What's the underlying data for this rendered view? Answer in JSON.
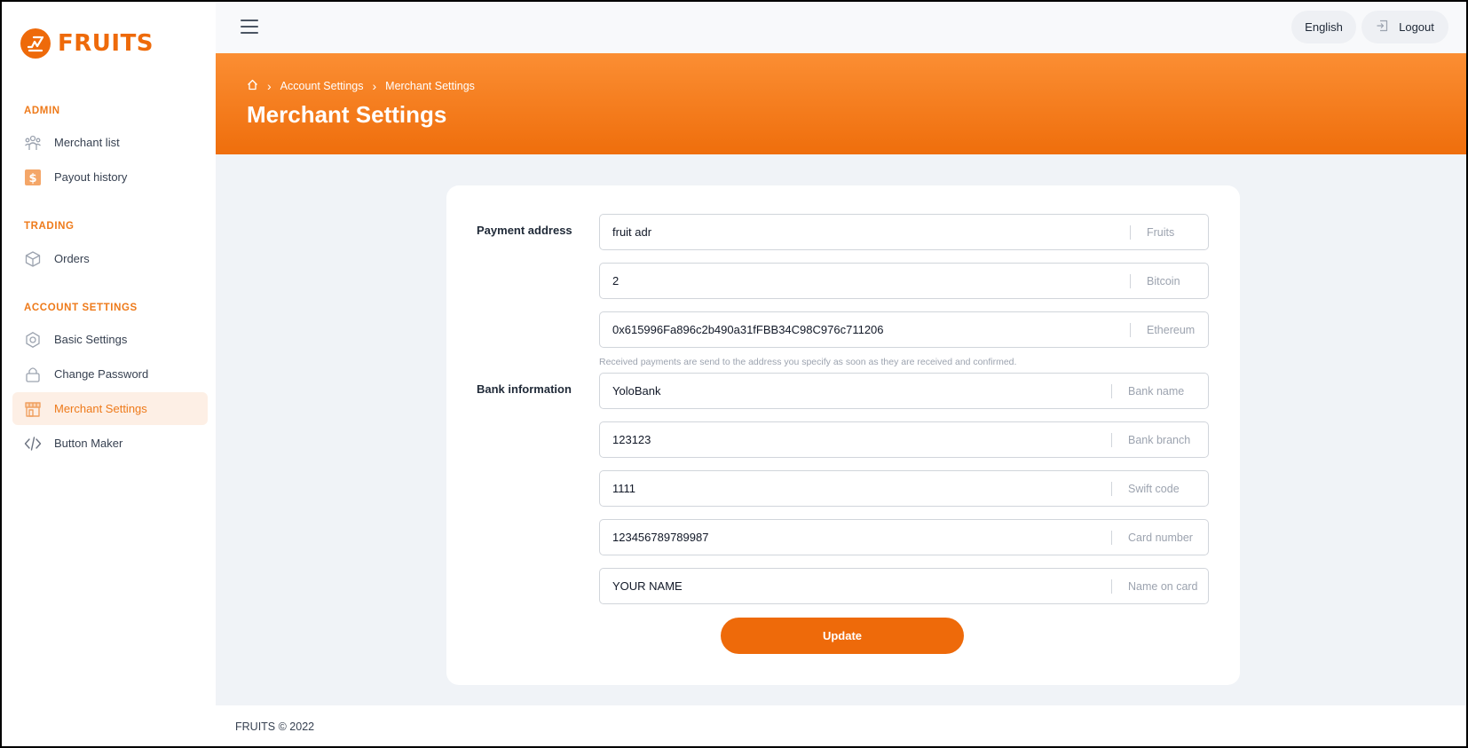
{
  "brand": {
    "name": "FRUITS",
    "accent": "#ee6a0a"
  },
  "sidebar": {
    "sections": [
      {
        "title": "ADMIN",
        "items": [
          {
            "label": "Merchant list",
            "icon": "users-icon"
          },
          {
            "label": "Payout history",
            "icon": "dollar-icon"
          }
        ]
      },
      {
        "title": "TRADING",
        "items": [
          {
            "label": "Orders",
            "icon": "box-icon"
          }
        ]
      },
      {
        "title": "ACCOUNT SETTINGS",
        "items": [
          {
            "label": "Basic Settings",
            "icon": "gear-icon"
          },
          {
            "label": "Change Password",
            "icon": "lock-icon"
          },
          {
            "label": "Merchant Settings",
            "icon": "store-icon",
            "active": true
          },
          {
            "label": "Button Maker",
            "icon": "code-icon"
          }
        ]
      }
    ]
  },
  "topbar": {
    "language": "English",
    "logout": "Logout"
  },
  "breadcrumb": {
    "items": [
      "Account Settings",
      "Merchant Settings"
    ]
  },
  "page": {
    "title": "Merchant Settings"
  },
  "form": {
    "payment_label": "Payment address",
    "payment_fields": [
      {
        "value": "fruit adr",
        "suffix": "Fruits"
      },
      {
        "value": "2",
        "suffix": "Bitcoin"
      },
      {
        "value": "0x615996Fa896c2b490a31fFBB34C98C976c711206",
        "suffix": "Ethereum"
      }
    ],
    "help_text": "Received payments are send to the address you specify as soon as they are received and confirmed.",
    "bank_label": "Bank information",
    "bank_fields": [
      {
        "value": "YoloBank",
        "suffix": "Bank name"
      },
      {
        "value": "123123",
        "suffix": "Bank branch"
      },
      {
        "value": "1111",
        "suffix": "Swift code"
      },
      {
        "value": "123456789789987",
        "suffix": "Card number"
      },
      {
        "value": "YOUR NAME",
        "suffix": "Name on card"
      }
    ],
    "submit": "Update"
  },
  "footer": {
    "text": "FRUITS © 2022"
  }
}
